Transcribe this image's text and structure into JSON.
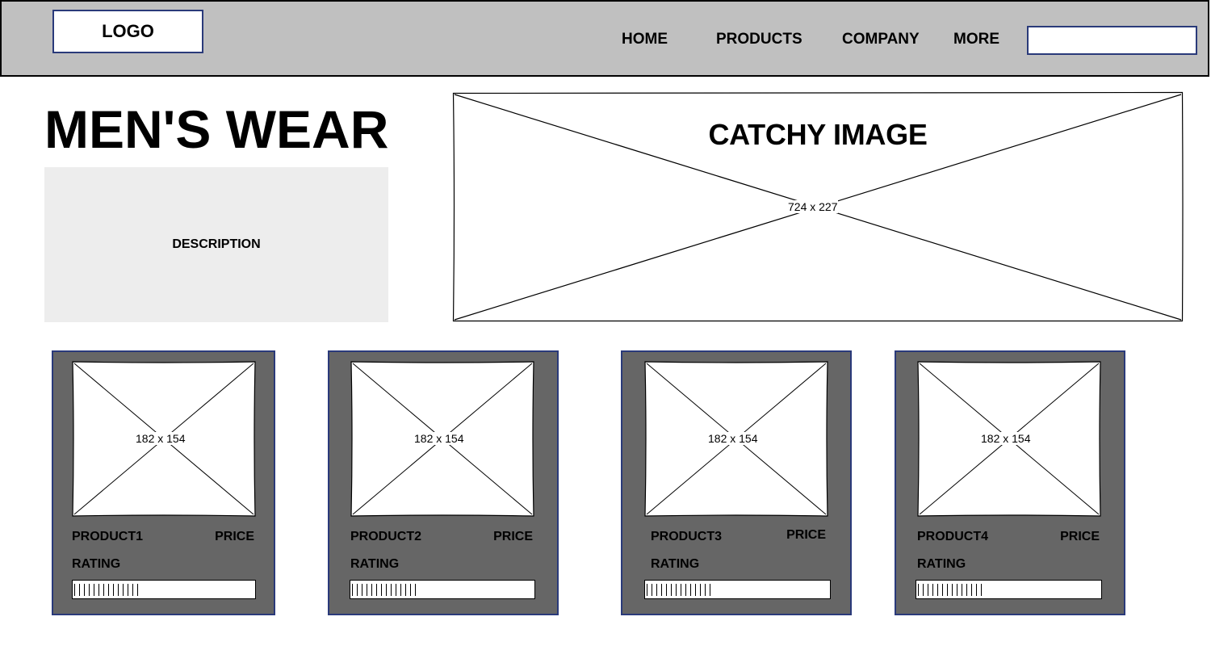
{
  "header": {
    "logo": "LOGO",
    "nav": [
      "HOME",
      "PRODUCTS",
      "COMPANY",
      "MORE"
    ],
    "search_value": ""
  },
  "main": {
    "title": "MEN'S WEAR",
    "description": "DESCRIPTION",
    "hero": {
      "title": "CATCHY IMAGE",
      "dimensions": "724 x 227"
    }
  },
  "products": [
    {
      "name": "PRODUCT1",
      "price_label": "PRICE",
      "rating_label": "RATING",
      "image_dimensions": "182 x 154"
    },
    {
      "name": "PRODUCT2",
      "price_label": "PRICE",
      "rating_label": "RATING",
      "image_dimensions": "182 x 154"
    },
    {
      "name": "PRODUCT3",
      "price_label": "PRICE",
      "rating_label": "RATING",
      "image_dimensions": "182 x 154"
    },
    {
      "name": "PRODUCT4",
      "price_label": "PRICE",
      "rating_label": "RATING",
      "image_dimensions": "182 x 154"
    }
  ],
  "colors": {
    "header_bg": "#c0c0c0",
    "accent_border": "#2a3a7a",
    "card_bg": "#666666",
    "description_bg": "#ededed"
  }
}
